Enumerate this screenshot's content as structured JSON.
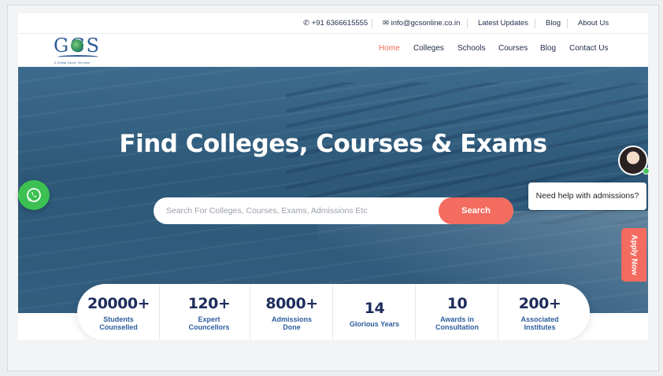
{
  "topbar": {
    "phone": "+91 6366615555",
    "email": "info@gcsonline.co.in",
    "links": [
      "Latest Updates",
      "Blog",
      "About Us"
    ]
  },
  "logo": {
    "letters": "GCS",
    "tagline": "A Global Career Services"
  },
  "nav": {
    "items": [
      "Home",
      "Colleges",
      "Schools",
      "Courses",
      "Blog",
      "Contact Us"
    ],
    "active": "Home"
  },
  "hero": {
    "title": "Find Colleges, Courses & Exams",
    "search_placeholder": "Search For Colleges, Courses, Exams, Admissions Etc",
    "search_button": "Search"
  },
  "stats": [
    {
      "value": "20000+",
      "label1": "Students",
      "label2": "Counselled"
    },
    {
      "value": "120+",
      "label1": "Expert",
      "label2": "Councellors"
    },
    {
      "value": "8000+",
      "label1": "Admissions",
      "label2": "Done"
    },
    {
      "value": "14",
      "label1": "Glorious Years",
      "label2": ""
    },
    {
      "value": "10",
      "label1": "Awards in",
      "label2": "Consultation"
    },
    {
      "value": "200+",
      "label1": "Associated",
      "label2": "Institutes"
    }
  ],
  "widgets": {
    "help_text": "Need help with admissions?",
    "apply_label": "Apply Now"
  },
  "colors": {
    "accent": "#f46b5f",
    "navy": "#1e2d5c",
    "whatsapp": "#3cc152"
  }
}
